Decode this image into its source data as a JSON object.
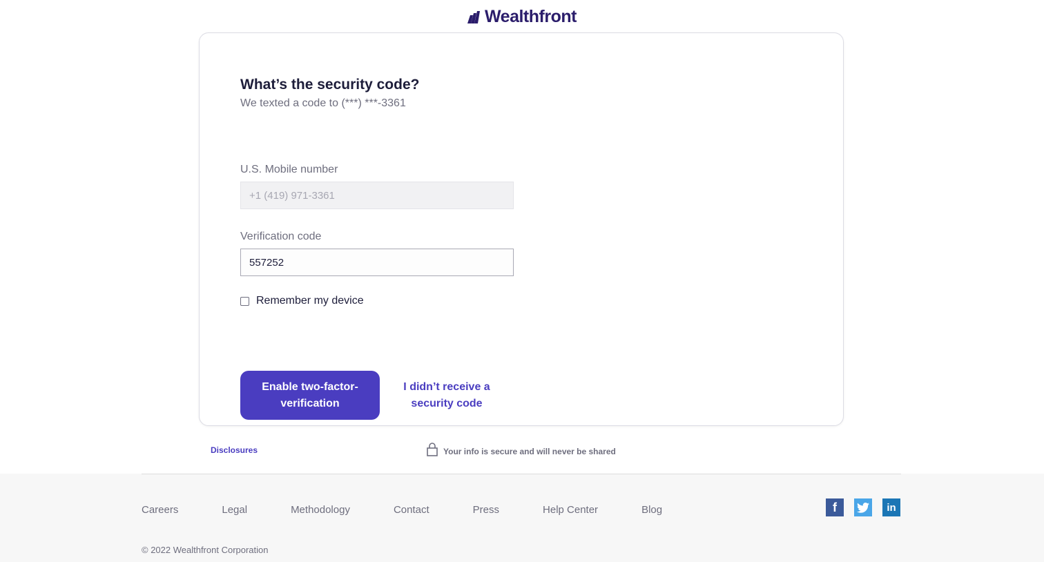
{
  "brand": {
    "name": "Wealthfront",
    "color": "#2b1d6b",
    "accent": "#4a3dc0"
  },
  "form": {
    "title": "What’s the security code?",
    "subtitle": "We texted a code to (***) ***-3361",
    "mobile": {
      "label": "U.S. Mobile number",
      "value": "+1 (419) 971-3361"
    },
    "code": {
      "label": "Verification code",
      "value": "557252"
    },
    "remember": {
      "label": "Remember my device",
      "checked": false
    },
    "submit_label": "Enable two-factor-verification",
    "resend_label": "I didn’t receive a security code"
  },
  "below_card": {
    "disclosures_label": "Disclosures",
    "secure_text": "Your info is secure and will never be shared"
  },
  "footer": {
    "links": [
      "Careers",
      "Legal",
      "Methodology",
      "Contact",
      "Press",
      "Help Center",
      "Blog"
    ],
    "social": [
      {
        "icon": "facebook-icon",
        "color": "#3b5a9a"
      },
      {
        "icon": "twitter-icon",
        "color": "#4aa6e8"
      },
      {
        "icon": "linkedin-icon",
        "color": "#1b76b5"
      }
    ],
    "copyright": "© 2022 Wealthfront Corporation"
  }
}
